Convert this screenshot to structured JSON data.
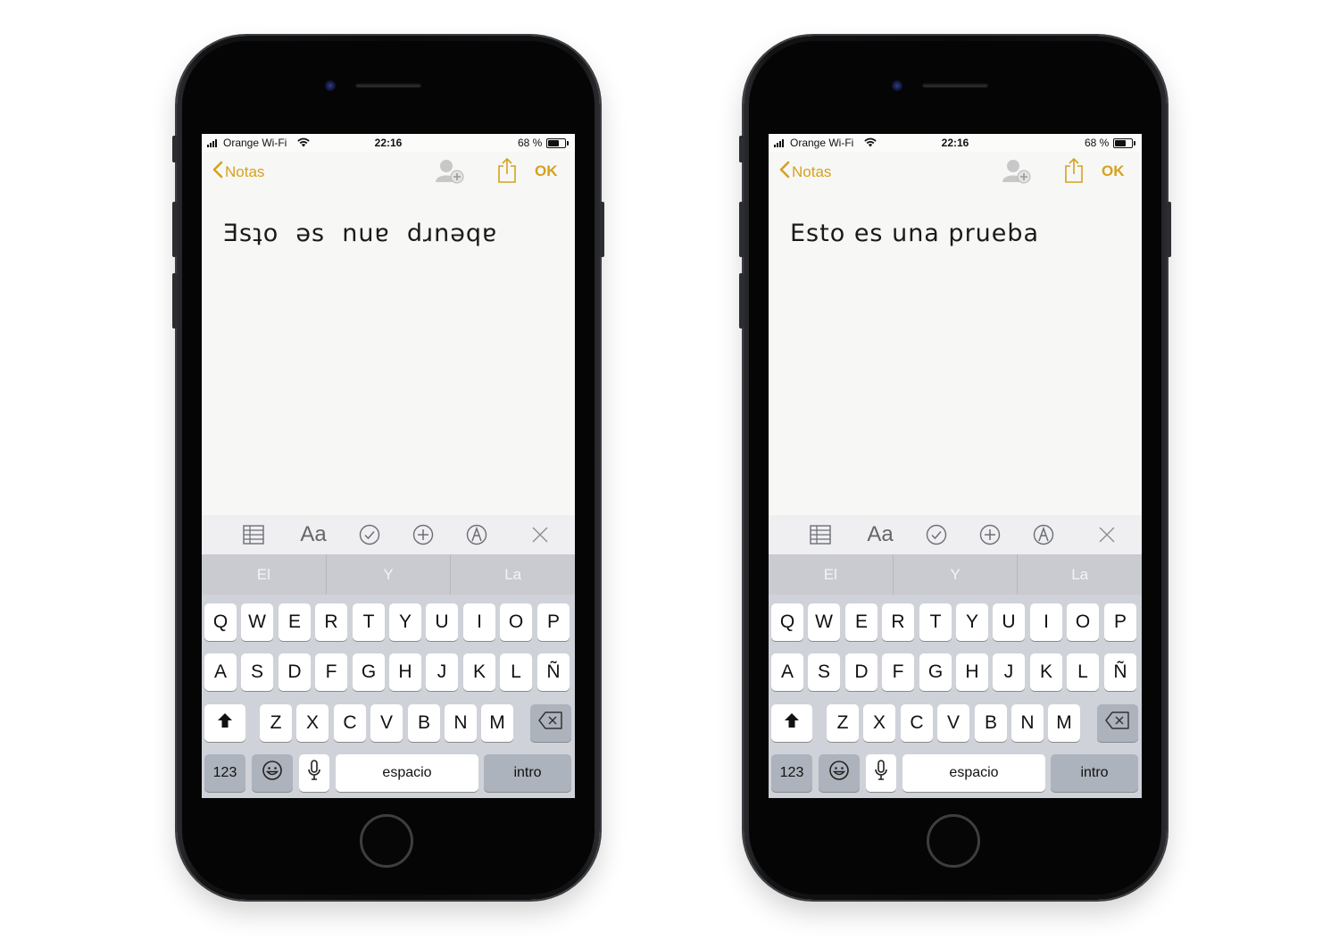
{
  "colors": {
    "accent": "#d4a21e",
    "key_bg": "#ffffff",
    "function_key_bg": "#adb3bc",
    "keyboard_bg": "#cfd2d8",
    "suggestion_bg": "#c9cbd1"
  },
  "status_bar": {
    "carrier": "Orange Wi-Fi",
    "time": "22:16",
    "battery": "68 %",
    "battery_level": 0.68
  },
  "nav": {
    "back_label": "Notas",
    "done_label": "OK",
    "icons": [
      "collaborate-icon",
      "share-icon"
    ]
  },
  "phones": [
    {
      "note_text": "Ǝsʇo  ǝs  nuɐ  dɹnǝqɐ"
    },
    {
      "note_text": "Esto es una prueba"
    }
  ],
  "toolbar": {
    "format_label": "Aa",
    "icons": [
      "table-icon",
      "checklist-icon",
      "add-icon",
      "markup-icon",
      "close-icon"
    ]
  },
  "suggestions": [
    "El",
    "Y",
    "La"
  ],
  "keyboard": {
    "row1": [
      "Q",
      "W",
      "E",
      "R",
      "T",
      "Y",
      "U",
      "I",
      "O",
      "P"
    ],
    "row2": [
      "A",
      "S",
      "D",
      "F",
      "G",
      "H",
      "J",
      "K",
      "L",
      "Ñ"
    ],
    "row3": [
      "Z",
      "X",
      "C",
      "V",
      "B",
      "N",
      "M"
    ],
    "numbers_label": "123",
    "space_label": "espacio",
    "return_label": "intro"
  }
}
